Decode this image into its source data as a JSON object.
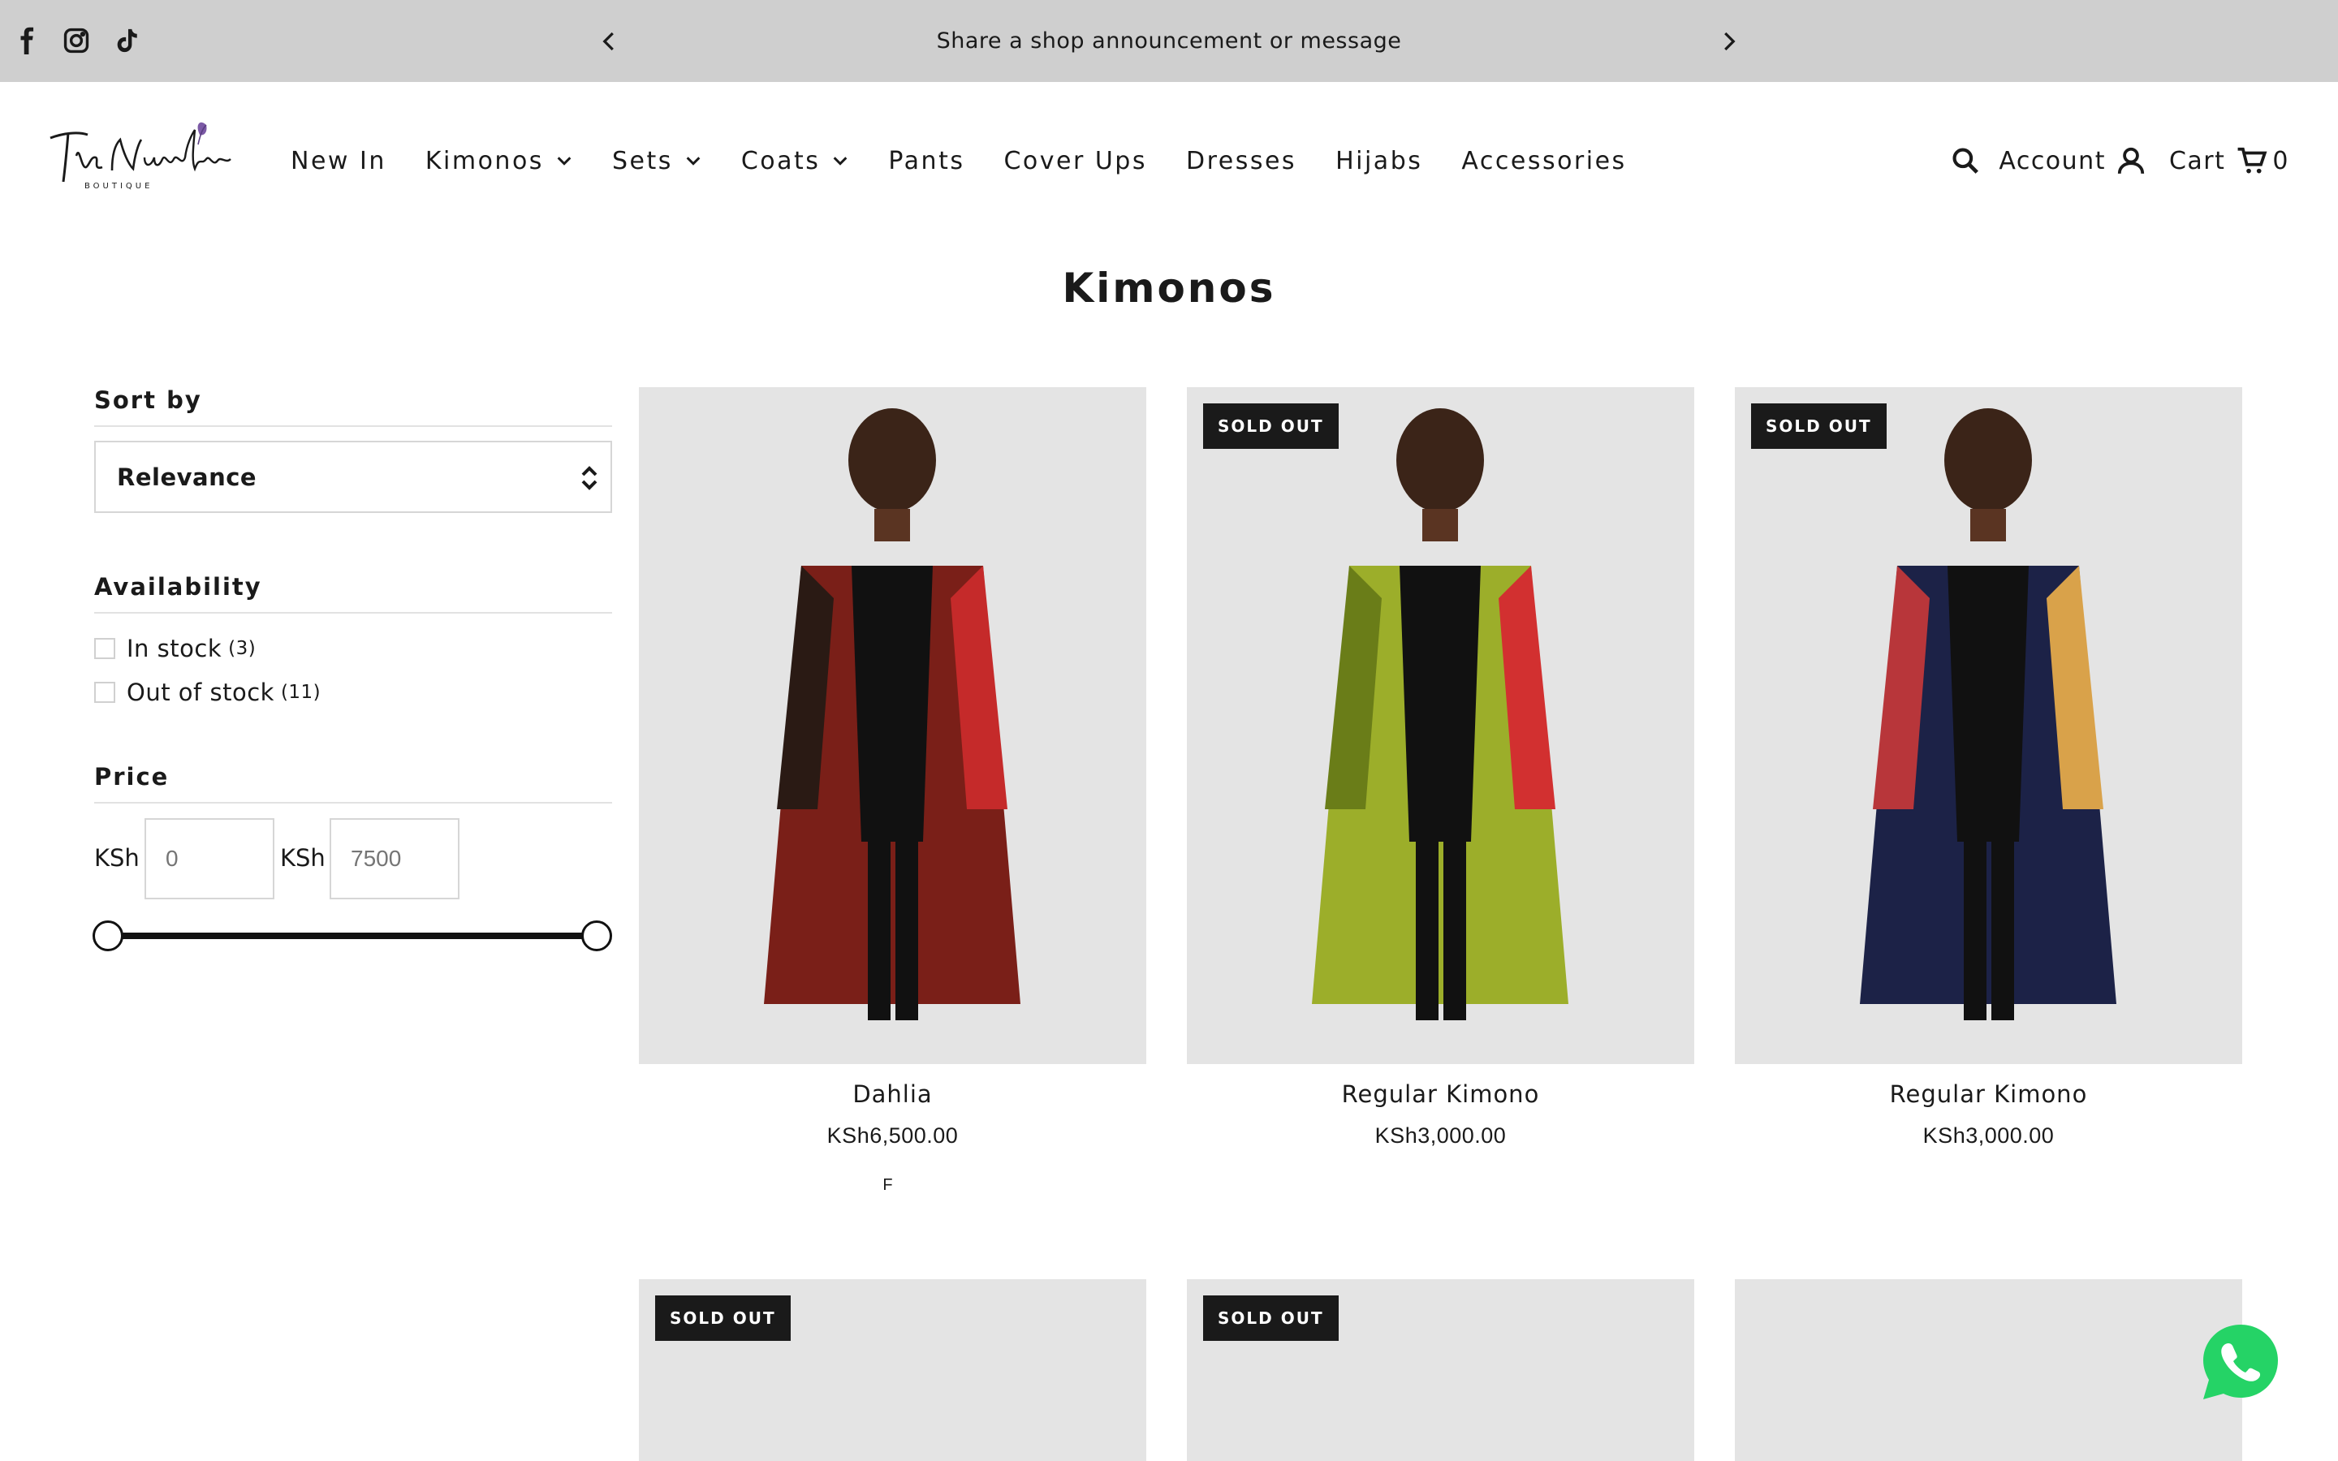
{
  "announcement": {
    "message": "Share a shop announcement or message",
    "social": [
      "facebook-icon",
      "instagram-icon",
      "tiktok-icon"
    ]
  },
  "header": {
    "logo_text": "The Nuralains",
    "logo_subtext": "BOUTIQUE",
    "nav": [
      {
        "label": "New In",
        "has_dropdown": false
      },
      {
        "label": "Kimonos",
        "has_dropdown": true
      },
      {
        "label": "Sets",
        "has_dropdown": true
      },
      {
        "label": "Coats",
        "has_dropdown": true
      },
      {
        "label": "Pants",
        "has_dropdown": false
      },
      {
        "label": "Cover Ups",
        "has_dropdown": false
      },
      {
        "label": "Dresses",
        "has_dropdown": false
      },
      {
        "label": "Hijabs",
        "has_dropdown": false
      },
      {
        "label": "Accessories",
        "has_dropdown": false
      }
    ],
    "account_label": "Account",
    "cart_label": "Cart",
    "cart_count": "0"
  },
  "page": {
    "title": "Kimonos"
  },
  "filters": {
    "sort_heading": "Sort by",
    "sort_value": "Relevance",
    "availability_heading": "Availability",
    "availability": [
      {
        "label": "In stock",
        "count": "(3)"
      },
      {
        "label": "Out of stock",
        "count": "(11)"
      }
    ],
    "price_heading": "Price",
    "currency": "KSh",
    "price_min_placeholder": "0",
    "price_max_placeholder": "7500"
  },
  "products": [
    {
      "title": "Dahlia",
      "price": "KSh6,500.00",
      "badge": "",
      "note": "F",
      "colors": [
        "#7a1f18",
        "#2a1a14",
        "#c52a2a"
      ]
    },
    {
      "title": "Regular Kimono",
      "price": "KSh3,000.00",
      "badge": "SOLD OUT",
      "note": "",
      "colors": [
        "#9cae2a",
        "#6a7d18",
        "#d23030"
      ]
    },
    {
      "title": "Regular Kimono",
      "price": "KSh3,000.00",
      "badge": "SOLD OUT",
      "note": "",
      "colors": [
        "#1c2247",
        "#b8363a",
        "#d9a24a"
      ]
    },
    {
      "title": "",
      "price": "",
      "badge": "SOLD OUT",
      "note": "",
      "colors": [
        "#e4e4e4",
        "#e4e4e4",
        "#e4e4e4"
      ]
    },
    {
      "title": "",
      "price": "",
      "badge": "SOLD OUT",
      "note": "",
      "colors": [
        "#2a4fa0",
        "#d23030",
        "#e2b33a"
      ]
    },
    {
      "title": "",
      "price": "",
      "badge": "",
      "note": "",
      "colors": [
        "#e4e4e4",
        "#e4e4e4",
        "#e4e4e4"
      ]
    }
  ],
  "colors": {
    "announcement_bg": "#cfcfcf",
    "badge_bg": "#1a1a1a",
    "whatsapp": "#25d366"
  }
}
